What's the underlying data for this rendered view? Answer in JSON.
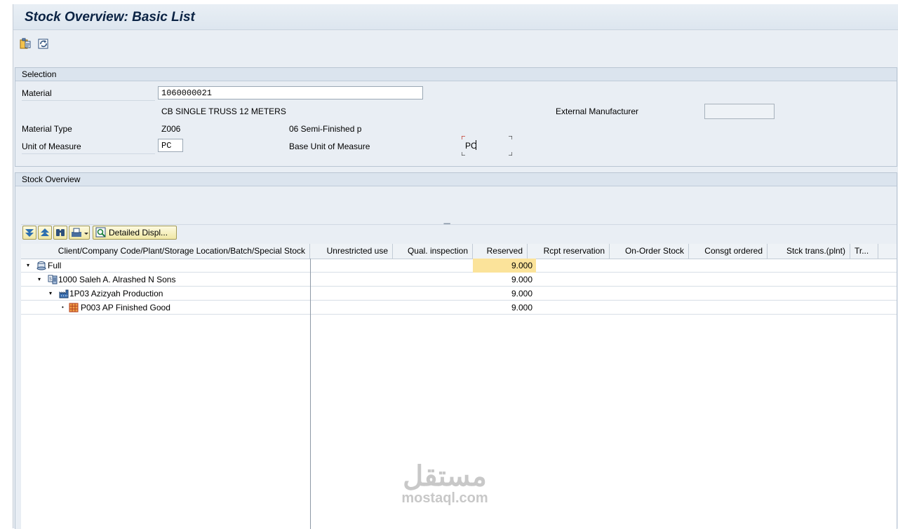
{
  "window": {
    "title": "Stock Overview: Basic List"
  },
  "toolbar": {
    "buttons": [
      "clipboard-icon",
      "refresh-icon"
    ]
  },
  "selection": {
    "panel_title": "Selection",
    "material_label": "Material",
    "material_value": "1060000021",
    "material_description": "CB SINGLE TRUSS 12 METERS",
    "external_manufacturer_label": "External Manufacturer",
    "external_manufacturer_value": "",
    "material_type_label": "Material Type",
    "material_type_code": "Z006",
    "material_type_text": "06 Semi-Finished p",
    "uom_label": "Unit of Measure",
    "uom_value": "PC",
    "base_uom_label": "Base Unit of Measure",
    "base_uom_value": "PC"
  },
  "stock_overview": {
    "panel_title": "Stock Overview",
    "detailed_display_label": "Detailed Displ...",
    "columns": [
      "Client/Company Code/Plant/Storage Location/Batch/Special Stock",
      "Unrestricted use",
      "Qual. inspection",
      "Reserved",
      "Rcpt reservation",
      "On-Order Stock",
      "Consgt ordered",
      "Stck trans.(plnt)",
      "Tr..."
    ],
    "rows": [
      {
        "label": "Full",
        "reserved": "9.000",
        "expander": "▾"
      },
      {
        "label": "1000 Saleh A. Alrashed N Sons",
        "reserved": "9.000",
        "expander": "▾"
      },
      {
        "label": "1P03 Azizyah Production",
        "reserved": "9.000",
        "expander": "▾"
      },
      {
        "label": "P003 AP Finished Good",
        "reserved": "9.000",
        "expander": "•"
      }
    ]
  },
  "watermark": {
    "arabic": "مستقل",
    "latin": "mostaql.com"
  },
  "colors": {
    "highlight": "#fbe39a",
    "title": "#0b2344",
    "panel": "#e9eef4"
  }
}
